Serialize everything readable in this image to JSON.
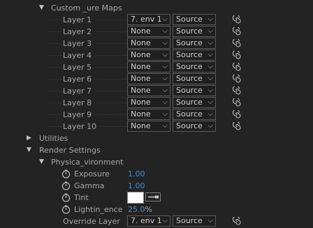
{
  "colors": {
    "background": "#232323",
    "text": "#a7a7a7",
    "value_blue": "#3a8fe3",
    "tint_swatch": "#ffffff"
  },
  "custom_maps": {
    "header": "Custom _ure Maps",
    "layers": [
      {
        "label": "Layer 1",
        "source": "7. env 1",
        "mode": "Source"
      },
      {
        "label": "Layer 2",
        "source": "None",
        "mode": "Source"
      },
      {
        "label": "Layer 3",
        "source": "None",
        "mode": "Source"
      },
      {
        "label": "Layer 4",
        "source": "None",
        "mode": "Source"
      },
      {
        "label": "Layer 5",
        "source": "None",
        "mode": "Source"
      },
      {
        "label": "Layer 6",
        "source": "None",
        "mode": "Source"
      },
      {
        "label": "Layer 7",
        "source": "None",
        "mode": "Source"
      },
      {
        "label": "Layer 8",
        "source": "None",
        "mode": "Source"
      },
      {
        "label": "Layer 9",
        "source": "None",
        "mode": "Source"
      },
      {
        "label": "Layer 10",
        "source": "None",
        "mode": "Source"
      }
    ]
  },
  "utilities": {
    "label": "Utilities"
  },
  "render_settings": {
    "label": "Render Settings",
    "physical_env": {
      "label": "Physica_vironment",
      "exposure": {
        "label": "Exposure",
        "value": "1.00"
      },
      "gamma": {
        "label": "Gamma",
        "value": "1.00"
      },
      "tint": {
        "label": "Tint"
      },
      "lighting": {
        "label": "Lightin_ence",
        "value": "25.0",
        "unit": "%"
      },
      "override": {
        "label": "Override Layer",
        "source": "7. env 1",
        "mode": "Source"
      }
    }
  }
}
